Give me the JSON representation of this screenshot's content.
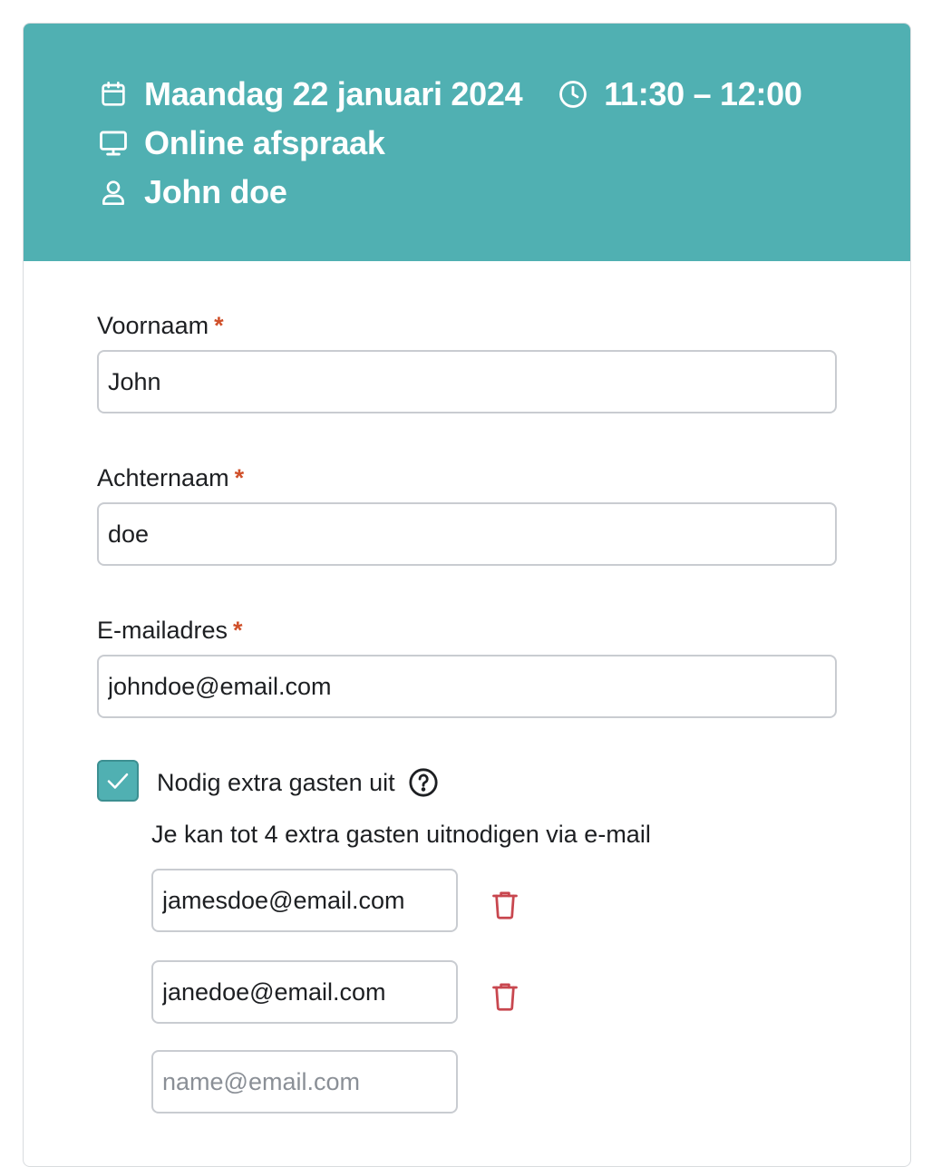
{
  "header": {
    "date": "Maandag 22 januari 2024",
    "time": "11:30 – 12:00",
    "location": "Online afspraak",
    "person": "John doe",
    "icons": [
      "calendar-icon",
      "clock-icon",
      "monitor-icon",
      "user-icon"
    ]
  },
  "form": {
    "first_name": {
      "label": "Voornaam",
      "required_mark": "*",
      "value": "John"
    },
    "last_name": {
      "label": "Achternaam",
      "required_mark": "*",
      "value": "doe"
    },
    "email": {
      "label": "E-mailadres",
      "required_mark": "*",
      "value": "johndoe@email.com"
    },
    "invite_guests": {
      "label": "Nodig extra gasten uit",
      "checked": true,
      "hint": "Je kan tot 4 extra gasten uitnodigen via e-mail",
      "guests": [
        {
          "value": "jamesdoe@email.com"
        },
        {
          "value": "janedoe@email.com"
        }
      ],
      "new_guest_placeholder": "name@email.com"
    }
  },
  "colors": {
    "header_bg": "#50b0b2",
    "required": "#d0502a",
    "delete": "#c8474f"
  }
}
